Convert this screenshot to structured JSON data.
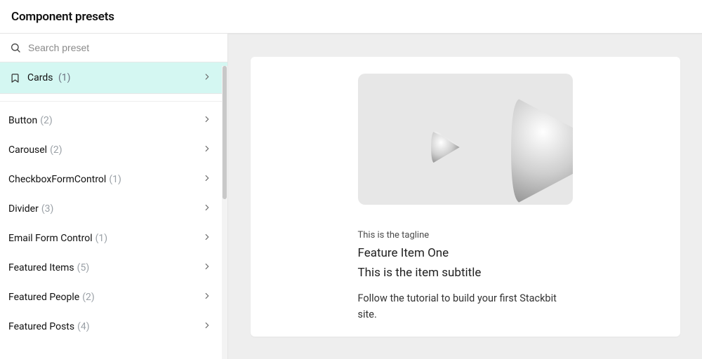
{
  "header": {
    "title": "Component presets"
  },
  "search": {
    "placeholder": "Search preset"
  },
  "activeItem": {
    "label": "Cards",
    "count": "(1)"
  },
  "sidebar": {
    "items": [
      {
        "label": "Button",
        "count": "(2)"
      },
      {
        "label": "Carousel",
        "count": "(2)"
      },
      {
        "label": "CheckboxFormControl",
        "count": "(1)"
      },
      {
        "label": "Divider",
        "count": "(3)"
      },
      {
        "label": "Email Form Control",
        "count": "(1)"
      },
      {
        "label": "Featured Items",
        "count": "(5)"
      },
      {
        "label": "Featured People",
        "count": "(2)"
      },
      {
        "label": "Featured Posts",
        "count": "(4)"
      }
    ]
  },
  "preview": {
    "tagline": "This is the tagline",
    "title": "Feature Item One",
    "subtitle": "This is the item subtitle",
    "description": "Follow the tutorial to build your first Stackbit site."
  }
}
